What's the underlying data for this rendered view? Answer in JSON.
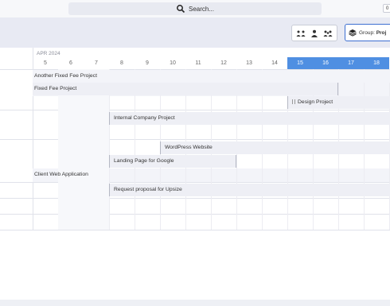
{
  "search": {
    "label": "Search..."
  },
  "top_right": {
    "label": "0"
  },
  "toolbar": {
    "view_icons": [
      "team-icon",
      "person-icon",
      "team-alt-icon"
    ],
    "group_label": "Group:",
    "group_value": "Proj"
  },
  "timeline": {
    "month": "APR 2024",
    "days": [
      "5",
      "6",
      "7",
      "8",
      "9",
      "10",
      "11",
      "12",
      "13",
      "14",
      "15",
      "16",
      "17",
      "18"
    ],
    "highlight_days": [
      "15",
      "16",
      "17",
      "18"
    ],
    "highlight_color": "#4f8fe2"
  },
  "bars": [
    {
      "label": "Another Fixed Fee Project"
    },
    {
      "label": "Fixed Fee Project"
    },
    {
      "label": "Design Project"
    },
    {
      "label": "Internal Company Project"
    },
    {
      "label": "WordPress Website"
    },
    {
      "label": "Landing Page for Google"
    },
    {
      "label": "Client Web Application"
    },
    {
      "label": "Request proposal for Upsize"
    }
  ]
}
